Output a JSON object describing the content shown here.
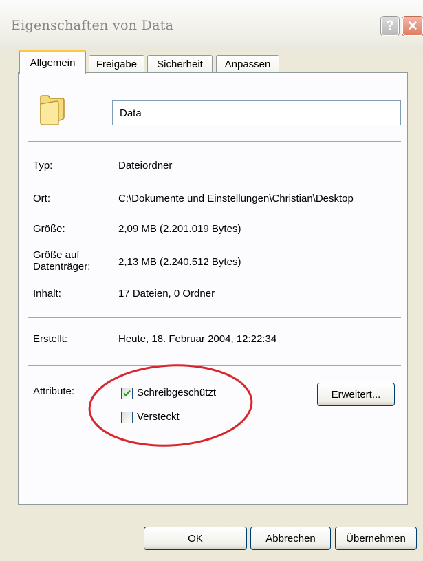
{
  "window": {
    "title": "Eigenschaften von Data",
    "help_glyph": "?",
    "close_glyph": "✕"
  },
  "tabs": [
    {
      "label": "Allgemein",
      "active": true
    },
    {
      "label": "Freigabe",
      "active": false
    },
    {
      "label": "Sicherheit",
      "active": false
    },
    {
      "label": "Anpassen",
      "active": false
    }
  ],
  "general": {
    "folder_icon": "folder-icon",
    "name_value": "Data",
    "typ_label": "Typ:",
    "typ_value": "Dateiordner",
    "ort_label": "Ort:",
    "ort_value": "C:\\Dokumente und Einstellungen\\Christian\\Desktop",
    "groesse_label": "Größe:",
    "groesse_value": "2,09 MB (2.201.019 Bytes)",
    "groesse_dt_label": "Größe auf Datenträger:",
    "groesse_dt_value": "2,13 MB (2.240.512 Bytes)",
    "inhalt_label": "Inhalt:",
    "inhalt_value": "17 Dateien, 0 Ordner",
    "erstellt_label": "Erstellt:",
    "erstellt_value": "Heute, 18. Februar 2004, 12:22:34"
  },
  "attributes": {
    "label": "Attribute:",
    "read_only_label": "Schreibgeschützt",
    "read_only_checked": true,
    "hidden_label": "Versteckt",
    "hidden_checked": false,
    "advanced_button": "Erweitert..."
  },
  "footer": {
    "ok": "OK",
    "cancel": "Abbrechen",
    "apply": "Übernehmen"
  },
  "colors": {
    "dialog_bg": "#ece9d8",
    "panel_bg": "#fcfcfe",
    "active_tab_accent": "#ffc83c",
    "annotation_circle": "#d9262c",
    "checkmark": "#21a121"
  }
}
